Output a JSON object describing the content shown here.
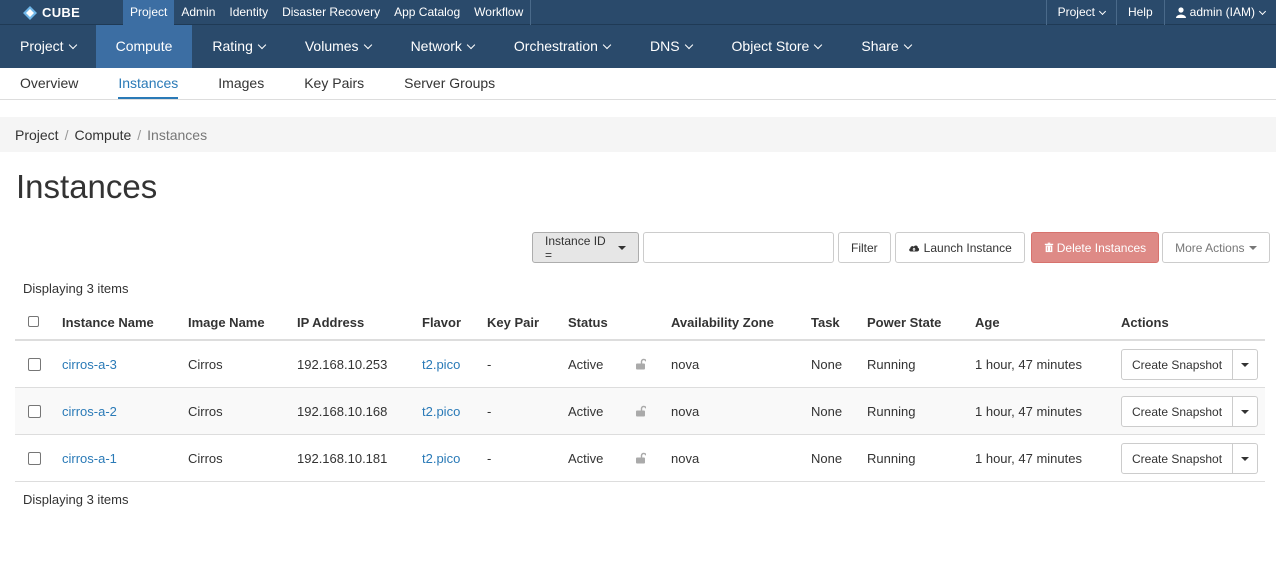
{
  "brand": {
    "name": "CUBE",
    "logo_icon": "cube-logo-icon"
  },
  "topnav": {
    "items": [
      "Project",
      "Admin",
      "Identity",
      "Disaster Recovery",
      "App Catalog",
      "Workflow"
    ],
    "active": "Project",
    "right": {
      "project": "Project",
      "help": "Help",
      "user": "admin (IAM)"
    }
  },
  "navbar2": {
    "items": [
      "Project",
      "Compute",
      "Rating",
      "Volumes",
      "Network",
      "Orchestration",
      "DNS",
      "Object Store",
      "Share"
    ],
    "active": "Compute"
  },
  "navbar3": {
    "items": [
      "Overview",
      "Instances",
      "Images",
      "Key Pairs",
      "Server Groups"
    ],
    "active": "Instances"
  },
  "breadcrumb": [
    "Project",
    "Compute",
    "Instances"
  ],
  "page": {
    "title": "Instances"
  },
  "toolbar": {
    "filter_select": "Instance ID =",
    "filter_input": "",
    "filter_button": "Filter",
    "launch_button": "Launch Instance",
    "delete_button": "Delete Instances",
    "more_button": "More Actions"
  },
  "table": {
    "count_label": "Displaying 3 items",
    "headers": [
      "Instance Name",
      "Image Name",
      "IP Address",
      "Flavor",
      "Key Pair",
      "Status",
      "Availability Zone",
      "Task",
      "Power State",
      "Age",
      "Actions"
    ],
    "rows": [
      {
        "name": "cirros-a-3",
        "image": "Cirros",
        "ip": "192.168.10.253",
        "flavor": "t2.pico",
        "keypair": "-",
        "status": "Active",
        "zone": "nova",
        "task": "None",
        "power": "Running",
        "age": "1 hour, 47 minutes",
        "action": "Create Snapshot"
      },
      {
        "name": "cirros-a-2",
        "image": "Cirros",
        "ip": "192.168.10.168",
        "flavor": "t2.pico",
        "keypair": "-",
        "status": "Active",
        "zone": "nova",
        "task": "None",
        "power": "Running",
        "age": "1 hour, 47 minutes",
        "action": "Create Snapshot"
      },
      {
        "name": "cirros-a-1",
        "image": "Cirros",
        "ip": "192.168.10.181",
        "flavor": "t2.pico",
        "keypair": "-",
        "status": "Active",
        "zone": "nova",
        "task": "None",
        "power": "Running",
        "age": "1 hour, 47 minutes",
        "action": "Create Snapshot"
      }
    ]
  },
  "colors": {
    "nav_bg": "#2a4a6b",
    "nav_active": "#3c6ea3",
    "link": "#2a7ab7",
    "danger": "#de8a86"
  }
}
